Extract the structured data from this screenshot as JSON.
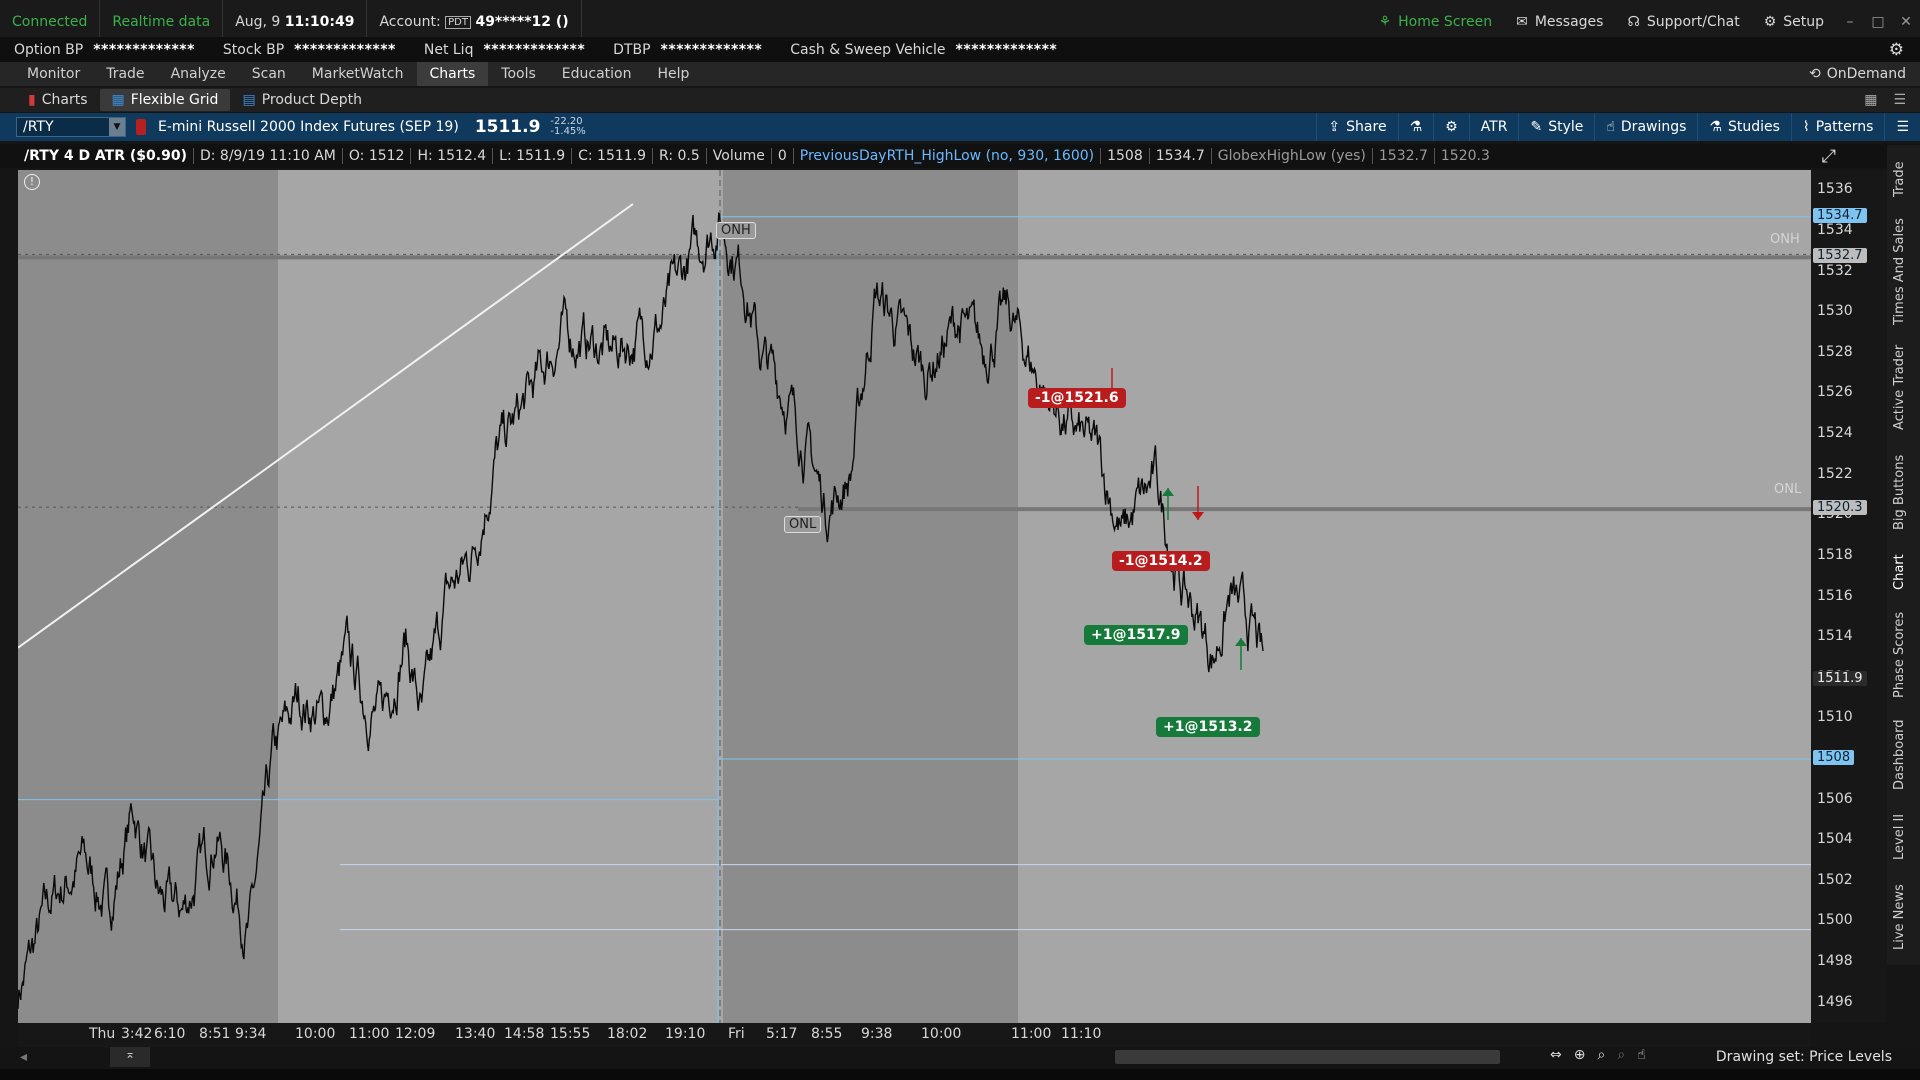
{
  "status": {
    "connected": "Connected",
    "realtime": "Realtime data",
    "date": "Aug, 9",
    "time": "11:10:49",
    "account_label": "Account:",
    "account_badge": "PDT",
    "account_number": "49*****12 ()",
    "home": "Home Screen",
    "messages": "Messages",
    "support": "Support/Chat",
    "setup": "Setup"
  },
  "balances": [
    {
      "label": "Option BP",
      "value": "*************"
    },
    {
      "label": "Stock BP",
      "value": "*************"
    },
    {
      "label": "Net Liq",
      "value": "*************"
    },
    {
      "label": "DTBP",
      "value": "*************"
    },
    {
      "label": "Cash & Sweep Vehicle",
      "value": "*************"
    }
  ],
  "menu": {
    "items": [
      "Monitor",
      "Trade",
      "Analyze",
      "Scan",
      "MarketWatch",
      "Charts",
      "Tools",
      "Education",
      "Help"
    ],
    "active": "Charts",
    "ondemand": "OnDemand"
  },
  "subtabs": {
    "items": [
      "Charts",
      "Flexible Grid",
      "Product Depth"
    ],
    "active": "Flexible Grid"
  },
  "chart_header": {
    "symbol": "/RTY",
    "description": "E-mini Russell 2000 Index Futures (SEP 19)",
    "last": "1511.9",
    "change": "-22.20",
    "change_pct": "-1.45%",
    "tools": [
      "Share",
      "ATR",
      "Style",
      "Drawings",
      "Studies",
      "Patterns"
    ]
  },
  "info": {
    "title": "/RTY 4 D ATR ($0.90)",
    "date": "D: 8/9/19 11:10 AM",
    "open": "O: 1512",
    "high": "H: 1512.4",
    "low": "L: 1511.9",
    "close": "C: 1511.9",
    "range": "R: 0.5",
    "volume_label": "Volume",
    "volume": "0",
    "study1": "PreviousDayRTH_HighLow (no, 930, 1600)",
    "study1_v1": "1508",
    "study1_v2": "1534.7",
    "study2": "GlobexHighLow (yes)",
    "study2_v1": "1532.7",
    "study2_v2": "1520.3"
  },
  "side_tabs": [
    "Trade",
    "Times And Sales",
    "Active Trader",
    "Big Buttons",
    "Chart",
    "Phase Scores",
    "Dashboard",
    "Level II",
    "Live News"
  ],
  "annotations": {
    "onh": "ONH",
    "onl": "ONL",
    "onh_right": "ONH",
    "onl_right": "ONL",
    "orders": [
      {
        "text": "-1@1521.6",
        "side": "sell",
        "price": 1521.6
      },
      {
        "text": "-1@1514.2",
        "side": "sell",
        "price": 1514.2
      },
      {
        "text": "+1@1517.9",
        "side": "buy",
        "price": 1517.9
      },
      {
        "text": "+1@1513.2",
        "side": "buy",
        "price": 1513.2
      }
    ]
  },
  "price_flags": [
    {
      "text": "1534.7",
      "price": 1534.7,
      "color": "#7fc4f0"
    },
    {
      "text": "1532.7",
      "price": 1532.7,
      "color": "#bdbdbd"
    },
    {
      "text": "1520.3",
      "price": 1520.3,
      "color": "#bdbdbd"
    },
    {
      "text": "1511.9",
      "price": 1511.9,
      "color": "#2b2b2b"
    },
    {
      "text": "1508",
      "price": 1508,
      "color": "#7fc4f0"
    }
  ],
  "bottom": {
    "drawing_set": "Drawing set: Price Levels"
  },
  "chart_data": {
    "type": "line",
    "title": "",
    "ylim": [
      1495,
      1537
    ],
    "y_ticks": [
      1536,
      1534,
      1532,
      1530,
      1528,
      1526,
      1524,
      1522,
      1520,
      1518,
      1516,
      1514,
      1512,
      1510,
      1508,
      1506,
      1504,
      1502,
      1500,
      1498,
      1496
    ],
    "x_ticks": [
      "Thu",
      "3:42",
      "6:10",
      "8:51",
      "9:34",
      "10:00",
      "11:00",
      "12:09",
      "13:40",
      "14:58",
      "15:55",
      "18:02",
      "19:10",
      "Fri",
      "5:17",
      "8:55",
      "9:38",
      "10:00",
      "11:00",
      "11:10"
    ],
    "series": [
      {
        "name": "",
        "anchors": [
          [
            0,
            1496.5
          ],
          [
            0.02,
            1501
          ],
          [
            0.04,
            1503
          ],
          [
            0.055,
            1500.5
          ],
          [
            0.07,
            1505.5
          ],
          [
            0.085,
            1501
          ],
          [
            0.1,
            1500.5
          ],
          [
            0.12,
            1504.5
          ],
          [
            0.14,
            1499.5
          ],
          [
            0.155,
            1508
          ],
          [
            0.17,
            1511
          ],
          [
            0.185,
            1510
          ],
          [
            0.2,
            1513
          ],
          [
            0.21,
            1511
          ],
          [
            0.22,
            1510
          ],
          [
            0.235,
            1514
          ],
          [
            0.245,
            1510
          ],
          [
            0.26,
            1516
          ],
          [
            0.275,
            1518
          ],
          [
            0.29,
            1523
          ],
          [
            0.305,
            1525
          ],
          [
            0.33,
            1529
          ],
          [
            0.36,
            1528
          ],
          [
            0.39,
            1529.5
          ],
          [
            0.41,
            1533
          ],
          [
            0.425,
            1534.6
          ],
          [
            0.44,
            1532
          ],
          [
            0.45,
            1528
          ],
          [
            0.465,
            1526
          ],
          [
            0.48,
            1523
          ],
          [
            0.49,
            1520.3
          ],
          [
            0.505,
            1522
          ],
          [
            0.52,
            1531
          ],
          [
            0.535,
            1529
          ],
          [
            0.55,
            1527
          ],
          [
            0.57,
            1529.5
          ],
          [
            0.585,
            1528
          ],
          [
            0.6,
            1530
          ],
          [
            0.62,
            1526.5
          ],
          [
            0.64,
            1524
          ],
          [
            0.655,
            1523
          ],
          [
            0.67,
            1519
          ],
          [
            0.68,
            1520.5
          ],
          [
            0.69,
            1521.6
          ],
          [
            0.705,
            1516.5
          ],
          [
            0.715,
            1515
          ],
          [
            0.725,
            1513
          ],
          [
            0.735,
            1516
          ],
          [
            0.75,
            1514
          ],
          [
            0.755,
            1512.5
          ]
        ]
      }
    ],
    "levels": [
      {
        "name": "ONH",
        "value": 1532.7
      },
      {
        "name": "ONL",
        "value": 1520.3
      },
      {
        "name": "Prev RTH High",
        "value": 1534.7
      },
      {
        "name": "Prev RTH Low",
        "value": 1508
      },
      {
        "name": "",
        "value": 1506
      },
      {
        "name": "",
        "value": 1502.8
      },
      {
        "name": "",
        "value": 1499.6
      }
    ]
  }
}
